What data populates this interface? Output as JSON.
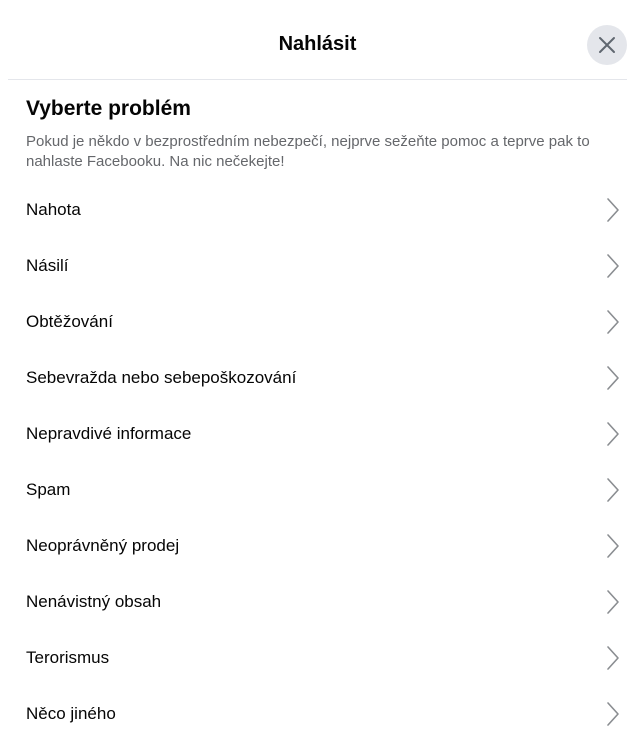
{
  "dialog": {
    "title": "Nahlásit",
    "close_icon": "close-icon"
  },
  "section": {
    "title": "Vyberte problém",
    "description": "Pokud je někdo v bezprostředním nebezpečí, nejprve sežeňte pomoc a teprve pak to nahlaste Facebooku. Na nic nečekejte!"
  },
  "items": [
    {
      "label": "Nahota",
      "icon": "chevron-right-icon"
    },
    {
      "label": "Násilí",
      "icon": "chevron-right-icon"
    },
    {
      "label": "Obtěžování",
      "icon": "chevron-right-icon"
    },
    {
      "label": "Sebevražda nebo sebepoškozování",
      "icon": "chevron-right-icon"
    },
    {
      "label": "Nepravdivé informace",
      "icon": "chevron-right-icon"
    },
    {
      "label": "Spam",
      "icon": "chevron-right-icon"
    },
    {
      "label": "Neoprávněný prodej",
      "icon": "chevron-right-icon"
    },
    {
      "label": "Nenávistný obsah",
      "icon": "chevron-right-icon"
    },
    {
      "label": "Terorismus",
      "icon": "chevron-right-icon"
    },
    {
      "label": "Něco jiného",
      "icon": "chevron-right-icon"
    }
  ],
  "colors": {
    "text_primary": "#050505",
    "text_secondary": "#65676b",
    "close_bg": "#e4e6eb",
    "divider": "#e4e6eb",
    "chevron": "#8a8d91"
  }
}
